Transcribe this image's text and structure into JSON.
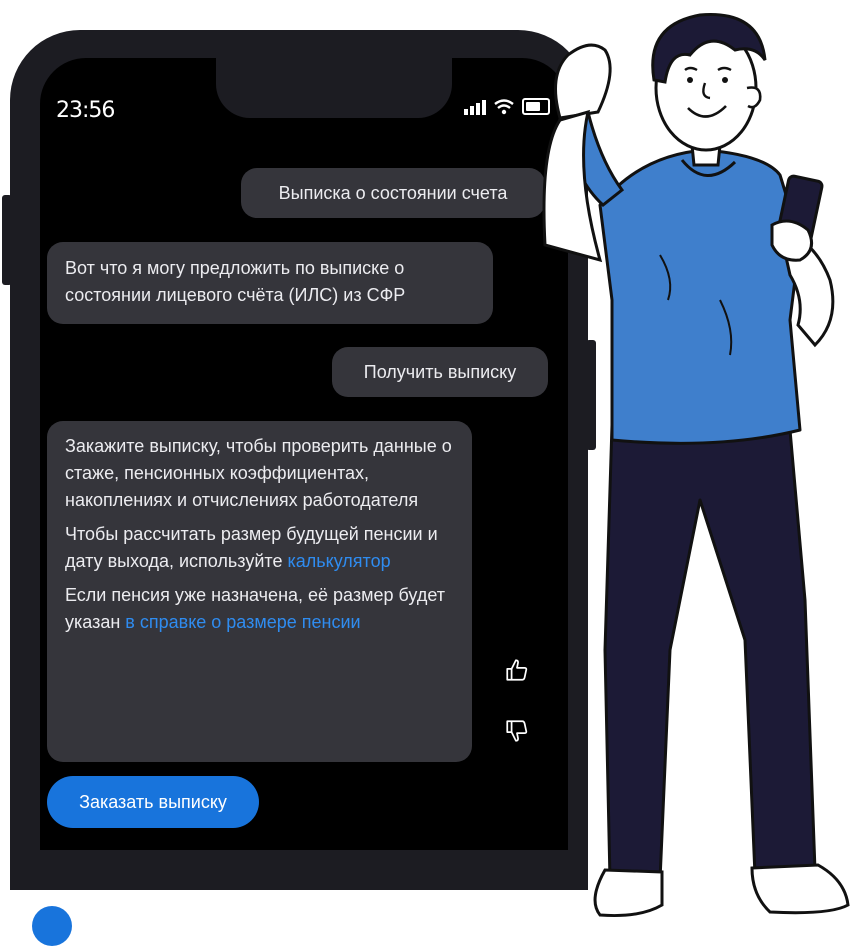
{
  "status_bar": {
    "time": "23:56"
  },
  "chat": {
    "messages": [
      {
        "role": "user",
        "text": "Выписка о состоянии счета"
      },
      {
        "role": "bot",
        "text": "Вот что я могу предложить по выписке о состоянии лицевого счёта (ИЛС) из СФР"
      },
      {
        "role": "user",
        "text": "Получить выписку"
      },
      {
        "role": "bot",
        "para1": "Закажите выписку, чтобы проверить данные о стаже, пенсионных коэффициентах, накоплениях и отчислениях работодателя",
        "para2_text": "Чтобы рассчитать размер будущей пенсии и дату выхода, используйте ",
        "para2_link": "калькулятор",
        "para3_text": "Если пенсия уже назначена, её размер будет указан ",
        "para3_link": "в справке о размере пенсии"
      }
    ],
    "action_button": "Заказать выписку",
    "reactions": {
      "like_icon": "thumbs-up-icon",
      "dislike_icon": "thumbs-down-icon"
    }
  },
  "colors": {
    "accent": "#1874dc",
    "link": "#2f8cf0",
    "bubble": "#35353b",
    "shirt": "#3f7fcc",
    "pants": "#1c1a36"
  }
}
